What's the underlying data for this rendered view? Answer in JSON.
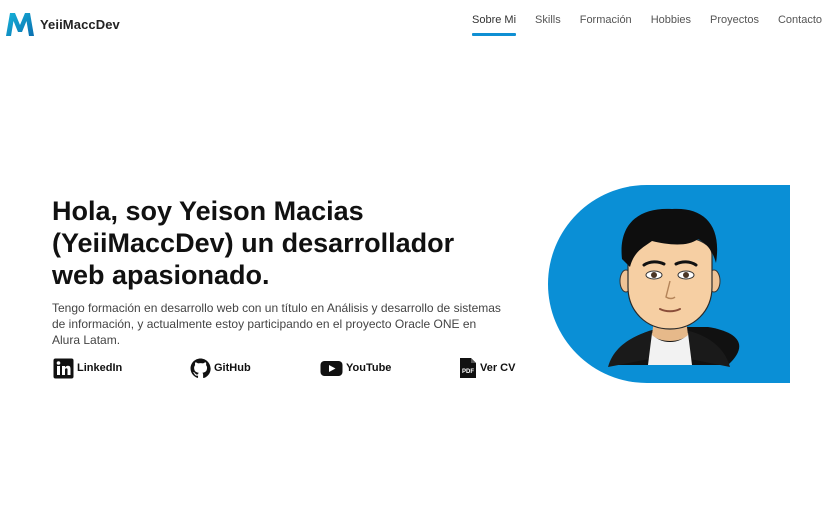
{
  "brand": {
    "logo_letter": "M",
    "name": "YeiiMaccDev"
  },
  "nav": {
    "items": [
      {
        "label": "Sobre Mi",
        "active": true
      },
      {
        "label": "Skills"
      },
      {
        "label": "Formación"
      },
      {
        "label": "Hobbies"
      },
      {
        "label": "Proyectos"
      },
      {
        "label": "Contacto"
      }
    ]
  },
  "hero": {
    "title": "Hola, soy Yeison Macias (YeiiMaccDev) un desarrollador web apasionado.",
    "description": "Tengo formación en desarrollo web con un título en Análisis y desarrollo de sistemas de información, y actualmente estoy participando en el proyecto Oracle ONE en Alura Latam.",
    "links": [
      {
        "label": "LinkedIn",
        "icon": "linkedin-icon"
      },
      {
        "label": "GitHub",
        "icon": "github-icon"
      },
      {
        "label": "YouTube",
        "icon": "youtube-icon"
      },
      {
        "label": "Ver CV",
        "icon": "pdf-icon",
        "icon_text": "PDF"
      }
    ]
  },
  "colors": {
    "accent": "#0f8fd3",
    "panel": "#0a8fd6",
    "text": "#111111"
  }
}
